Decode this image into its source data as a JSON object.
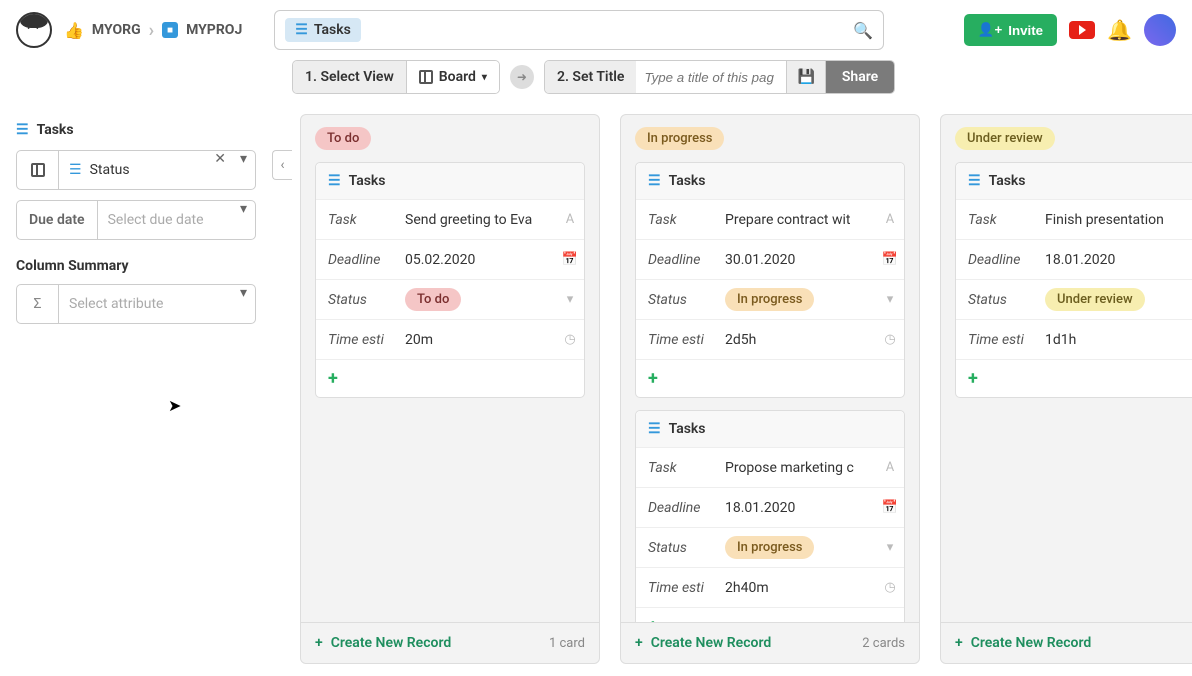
{
  "breadcrumb": {
    "org": "MYORG",
    "project": "MYPROJ"
  },
  "search": {
    "chip_label": "Tasks",
    "placeholder": ""
  },
  "header": {
    "invite": "Invite"
  },
  "toolbar": {
    "step1": "1. Select View",
    "board_label": "Board",
    "step2": "2. Set Title",
    "title_placeholder": "Type a title of this pag",
    "share": "Share"
  },
  "sidebar": {
    "title": "Tasks",
    "group_by": "Status",
    "filter_label": "Due date",
    "filter_placeholder": "Select due date",
    "summary_heading": "Column Summary",
    "summary_placeholder": "Select attribute"
  },
  "labels": {
    "record_heading": "Tasks",
    "task": "Task",
    "deadline": "Deadline",
    "status": "Status",
    "time": "Time esti",
    "create": "Create New Record"
  },
  "columns": [
    {
      "status": "To do",
      "pill_class": "pill-todo",
      "count_text": "1 card",
      "cards": [
        {
          "task": "Send greeting to Eva",
          "deadline": "05.02.2020",
          "status": "To do",
          "pill_class": "pill-todo",
          "time": "20m"
        }
      ]
    },
    {
      "status": "In progress",
      "pill_class": "pill-progress",
      "count_text": "2 cards",
      "cards": [
        {
          "task": "Prepare contract wit",
          "deadline": "30.01.2020",
          "status": "In progress",
          "pill_class": "pill-progress",
          "time": "2d5h"
        },
        {
          "task": "Propose marketing c",
          "deadline": "18.01.2020",
          "status": "In progress",
          "pill_class": "pill-progress",
          "time": "2h40m"
        }
      ]
    },
    {
      "status": "Under review",
      "pill_class": "pill-review",
      "count_text": "",
      "cards": [
        {
          "task": "Finish presentation",
          "deadline": "18.01.2020",
          "status": "Under review",
          "pill_class": "pill-review",
          "time": "1d1h"
        }
      ]
    }
  ]
}
